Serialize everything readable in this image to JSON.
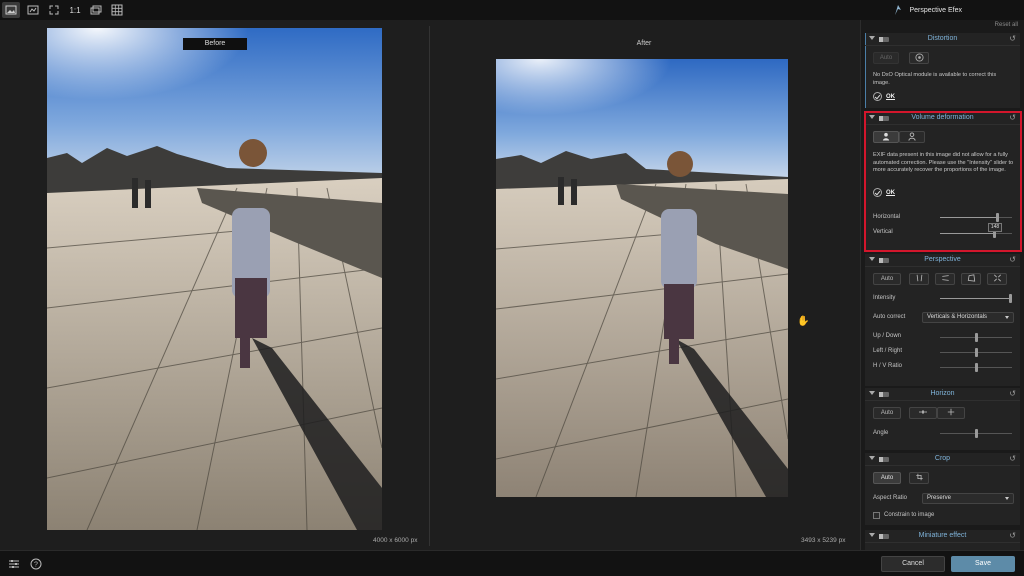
{
  "topbar": {
    "tools": [
      {
        "name": "single-view",
        "icon": "image-icon"
      },
      {
        "name": "compare-view",
        "icon": "compare-icon"
      },
      {
        "name": "fit",
        "icon": "fit-icon"
      },
      {
        "name": "one-to-one",
        "label": "1:1"
      },
      {
        "name": "layers",
        "icon": "layers-icon"
      },
      {
        "name": "grid",
        "icon": "grid-icon"
      }
    ],
    "app_title": "Perspective Efex"
  },
  "viewer": {
    "before_label": "Before",
    "after_label": "After",
    "before_dims": "4000 x 6000 px",
    "after_dims": "3493 x 5239 px"
  },
  "sidebar": {
    "reset_all": "Reset all",
    "distortion": {
      "title": "Distortion",
      "auto_label": "Auto",
      "note": "No DxO Optical module is available to correct this image.",
      "ok_label": "OK"
    },
    "volume": {
      "title": "Volume deformation",
      "note": "EXIF data present in this image did not allow for a fully automated correction. Please use the \"Intensity\" slider to more accurately recover the proportions of the image.",
      "ok_label": "OK",
      "horizontal_label": "Horizontal",
      "vertical_label": "Vertical",
      "vertical_value": "148",
      "horizontal_level": 0.78,
      "vertical_level": 0.74
    },
    "perspective": {
      "title": "Perspective",
      "auto_label": "Auto",
      "intensity_label": "Intensity",
      "auto_correct_label": "Auto correct",
      "auto_correct_value": "Verticals & Horizontals",
      "up_down_label": "Up / Down",
      "left_right_label": "Left / Right",
      "hv_ratio_label": "H / V Ratio",
      "intensity_level": 1.0
    },
    "horizon": {
      "title": "Horizon",
      "auto_label": "Auto",
      "angle_label": "Angle"
    },
    "crop": {
      "title": "Crop",
      "auto_label": "Auto",
      "aspect_ratio_label": "Aspect Ratio",
      "aspect_ratio_value": "Preserve",
      "constrain_label": "Constrain to image"
    },
    "miniature": {
      "title": "Miniature effect"
    }
  },
  "bottombar": {
    "cancel_label": "Cancel",
    "save_label": "Save"
  },
  "colors": {
    "accent": "#7fb3d9",
    "save": "#5d8ba8",
    "highlight": "#d3162c"
  }
}
